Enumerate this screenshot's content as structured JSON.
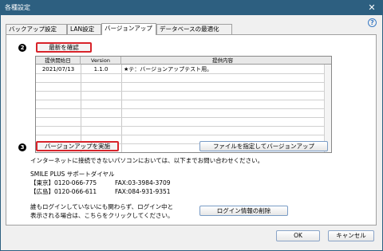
{
  "window": {
    "title": "各種設定",
    "close_glyph": "✕",
    "help_glyph": "?"
  },
  "tabs": [
    {
      "label": "バックアップ設定"
    },
    {
      "label": "LAN設定"
    },
    {
      "label": "バージョンアップ",
      "active": true
    },
    {
      "label": "データベースの最適化"
    }
  ],
  "section1": {
    "badge": "2",
    "button": "最新を確認"
  },
  "table": {
    "headers": [
      "提供開始日",
      "Version",
      "提供内容"
    ],
    "rows": [
      {
        "date": "2021/07/13",
        "version": "1.1.0",
        "content": "★テ：バージョンアップテスト用。"
      }
    ]
  },
  "section2": {
    "badge": "3",
    "button": "バージョンアップを実施",
    "file_button": "ファイルを指定してバージョンアップ",
    "note": "インターネットに接続できないパソコンにおいては、以下までお問い合わせください。",
    "support_title": "SMILE PLUS サポートダイヤル",
    "tokyo": {
      "label": "【東京】",
      "tel": "0120-066-775",
      "fax": "FAX:03-3984-3709"
    },
    "hiroshima": {
      "label": "【広島】",
      "tel": "0120-066-611",
      "fax": "FAX:084-931-9351"
    },
    "login_note1": "誰もログインしていないにも関わらず、ログイン中と",
    "login_note2": "表示される場合は、こちらをクリックしてください。",
    "login_button": "ログイン情報の削除"
  },
  "footer": {
    "ok": "OK",
    "cancel": "キャンセル"
  },
  "colors": {
    "titlebar": "#2d5f80",
    "highlight": "#d8232a"
  }
}
